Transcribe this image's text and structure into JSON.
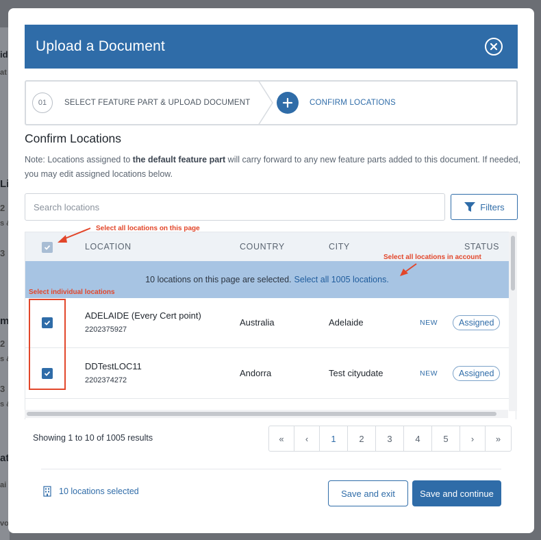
{
  "modal": {
    "title": "Upload a Document",
    "stepper": {
      "step1_number": "01",
      "step1_label": "SELECT FEATURE PART & UPLOAD DOCUMENT",
      "step2_label": "CONFIRM LOCATIONS"
    },
    "section_title": "Confirm Locations",
    "note": {
      "prefix": "Note: Locations assigned to ",
      "bold": "the default feature part",
      "suffix": " will carry forward to any new feature parts added to this document. If needed, you may edit assigned locations below."
    },
    "search": {
      "placeholder": "Search locations"
    },
    "filters_label": "Filters",
    "table": {
      "headers": {
        "location": "LOCATION",
        "country": "COUNTRY",
        "city": "CITY",
        "status": "STATUS"
      },
      "banner_text": "10 locations on this page are selected.",
      "banner_link": "Select all 1005 locations.",
      "rows": [
        {
          "name": "ADELAIDE (Every Cert point)",
          "id": "2202375927",
          "country": "Australia",
          "city": "Adelaide",
          "tag": "NEW",
          "status": "Assigned",
          "checked": true
        },
        {
          "name": "DDTestLOC11",
          "id": "2202374272",
          "country": "Andorra",
          "city": "Test cityudate",
          "tag": "NEW",
          "status": "Assigned",
          "checked": true
        }
      ]
    },
    "results_text": "Showing 1 to 10 of 1005 results",
    "pagination": {
      "first": "«",
      "prev": "‹",
      "pages": [
        "1",
        "2",
        "3",
        "4",
        "5"
      ],
      "current": "1",
      "next": "›",
      "last": "»"
    },
    "footer": {
      "selected_count": "10 locations selected",
      "save_exit": "Save and exit",
      "save_continue": "Save and continue"
    }
  },
  "annotations": {
    "header_checkbox": "Select all locations on this page",
    "select_all_account": "Select all locations in account",
    "individual": "Select individual locations"
  },
  "background": {
    "fragments": [
      "id",
      "at",
      "Lic",
      "2",
      "s &",
      "3",
      "m",
      "2",
      "s &",
      "3",
      "s &",
      "at",
      "ai",
      "vo"
    ]
  },
  "colors": {
    "primary": "#2f6ca8",
    "banner": "#a7c4e3",
    "annotation": "#e2462a"
  }
}
